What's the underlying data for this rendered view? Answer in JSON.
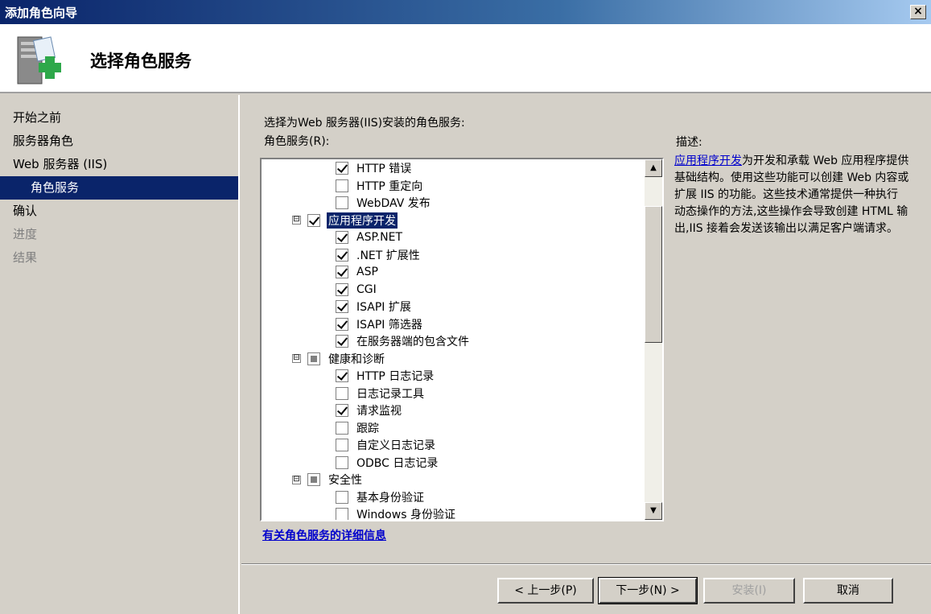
{
  "window": {
    "title": "添加角色向导",
    "close_label": "×"
  },
  "header": {
    "heading": "选择角色服务",
    "icon": "server-add-icon"
  },
  "nav": {
    "items": [
      {
        "label": "开始之前",
        "state": "normal"
      },
      {
        "label": "服务器角色",
        "state": "normal"
      },
      {
        "label": "Web 服务器 (IIS)",
        "state": "normal"
      },
      {
        "label": "角色服务",
        "state": "active"
      },
      {
        "label": "确认",
        "state": "normal"
      },
      {
        "label": "进度",
        "state": "disabled"
      },
      {
        "label": "结果",
        "state": "disabled"
      }
    ]
  },
  "main": {
    "prompt": "选择为Web 服务器(IIS)安装的角色服务:",
    "list_label": "角色服务(R):",
    "more_info_link": "有关角色服务的详细信息",
    "description_label": "描述:",
    "description_link": "应用程序开发",
    "description_text": "为开发和承载 Web 应用程序提供基础结构。使用这些功能可以创建 Web 内容或扩展 IIS 的功能。这些技术通常提供一种执行动态操作的方法,这些操作会导致创建 HTML 输出,IIS 接着会发送该输出以满足客户端请求。",
    "tree": [
      {
        "label": "HTTP 错误",
        "state": "checked",
        "level": 2
      },
      {
        "label": "HTTP 重定向",
        "state": "unchecked",
        "level": 2
      },
      {
        "label": "WebDAV 发布",
        "state": "unchecked",
        "level": 2
      },
      {
        "label": "应用程序开发",
        "state": "checked",
        "level": 1,
        "expander": "⊟",
        "selected": true
      },
      {
        "label": "ASP.NET",
        "state": "checked",
        "level": 2
      },
      {
        "label": ".NET 扩展性",
        "state": "checked",
        "level": 2
      },
      {
        "label": "ASP",
        "state": "checked",
        "level": 2
      },
      {
        "label": "CGI",
        "state": "checked",
        "level": 2
      },
      {
        "label": "ISAPI 扩展",
        "state": "checked",
        "level": 2
      },
      {
        "label": "ISAPI 筛选器",
        "state": "checked",
        "level": 2
      },
      {
        "label": "在服务器端的包含文件",
        "state": "checked",
        "level": 2
      },
      {
        "label": "健康和诊断",
        "state": "partial",
        "level": 1,
        "expander": "⊟"
      },
      {
        "label": "HTTP 日志记录",
        "state": "checked",
        "level": 2
      },
      {
        "label": "日志记录工具",
        "state": "unchecked",
        "level": 2
      },
      {
        "label": "请求监视",
        "state": "checked",
        "level": 2
      },
      {
        "label": "跟踪",
        "state": "unchecked",
        "level": 2
      },
      {
        "label": "自定义日志记录",
        "state": "unchecked",
        "level": 2
      },
      {
        "label": "ODBC 日志记录",
        "state": "unchecked",
        "level": 2
      },
      {
        "label": "安全性",
        "state": "partial",
        "level": 1,
        "expander": "⊟"
      },
      {
        "label": "基本身份验证",
        "state": "unchecked",
        "level": 2
      },
      {
        "label": "Windows 身份验证",
        "state": "unchecked",
        "level": 2
      }
    ]
  },
  "buttons": {
    "back": "< 上一步(P)",
    "next": "下一步(N) >",
    "install": "安装(I)",
    "cancel": "取消"
  }
}
